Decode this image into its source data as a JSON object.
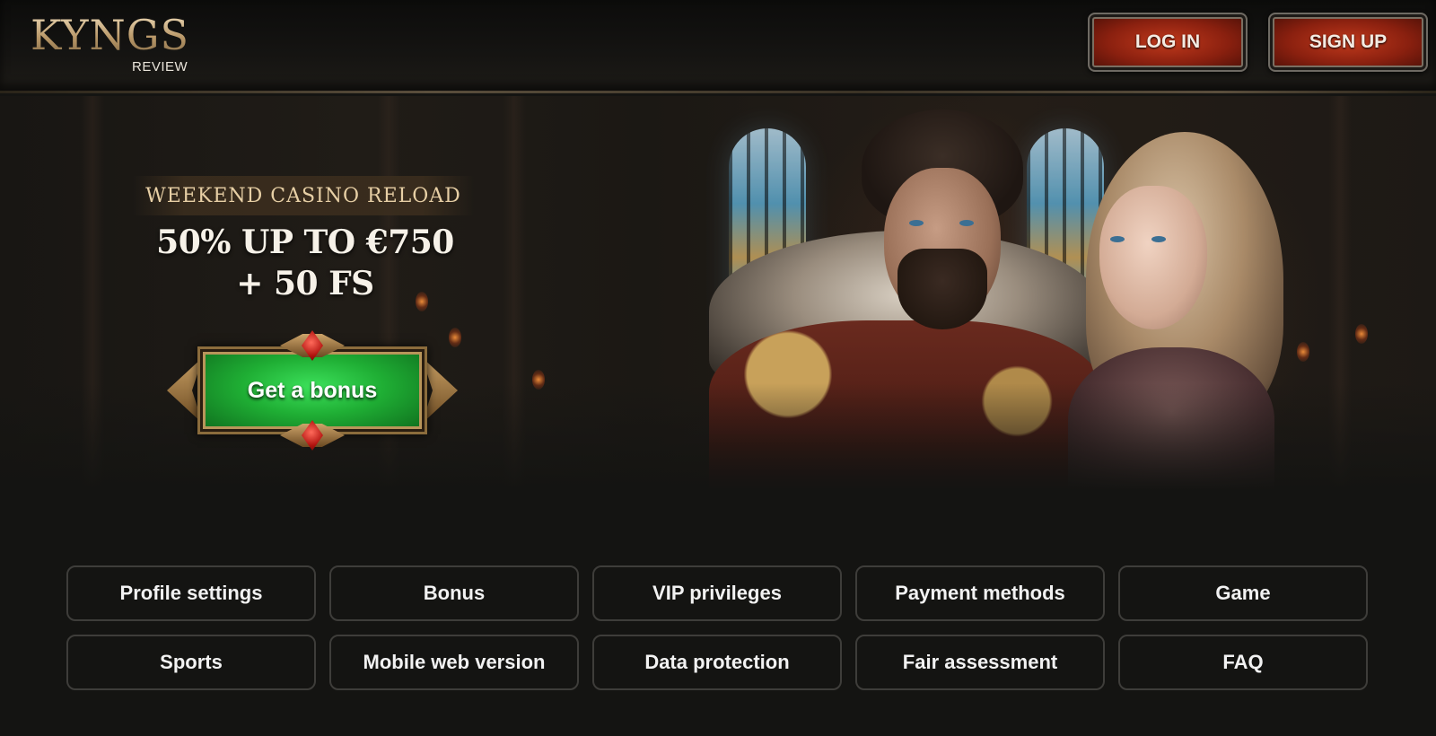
{
  "header": {
    "logo_main": "KYNGS",
    "logo_sub": "REVIEW",
    "login_label": "LOG IN",
    "signup_label": "SIGN UP"
  },
  "promo": {
    "label": "WEEKEND CASINO RELOAD",
    "line1": "50% UP TO €750",
    "line2": "+ 50 FS",
    "cta_label": "Get a bonus"
  },
  "nav": {
    "items": [
      {
        "label": "Profile settings"
      },
      {
        "label": "Bonus"
      },
      {
        "label": "VIP privileges"
      },
      {
        "label": "Payment methods"
      },
      {
        "label": "Game"
      },
      {
        "label": "Sports"
      },
      {
        "label": "Mobile web version"
      },
      {
        "label": "Data protection"
      },
      {
        "label": "Fair assessment"
      },
      {
        "label": "FAQ"
      }
    ]
  },
  "colors": {
    "background": "#141412",
    "header_button": "#8a200f",
    "cta_green": "#1fae34",
    "gold_accent": "#cdb48f"
  },
  "images": {
    "hero": "royal-couple-illustration",
    "logo": "kyngs-logo"
  }
}
